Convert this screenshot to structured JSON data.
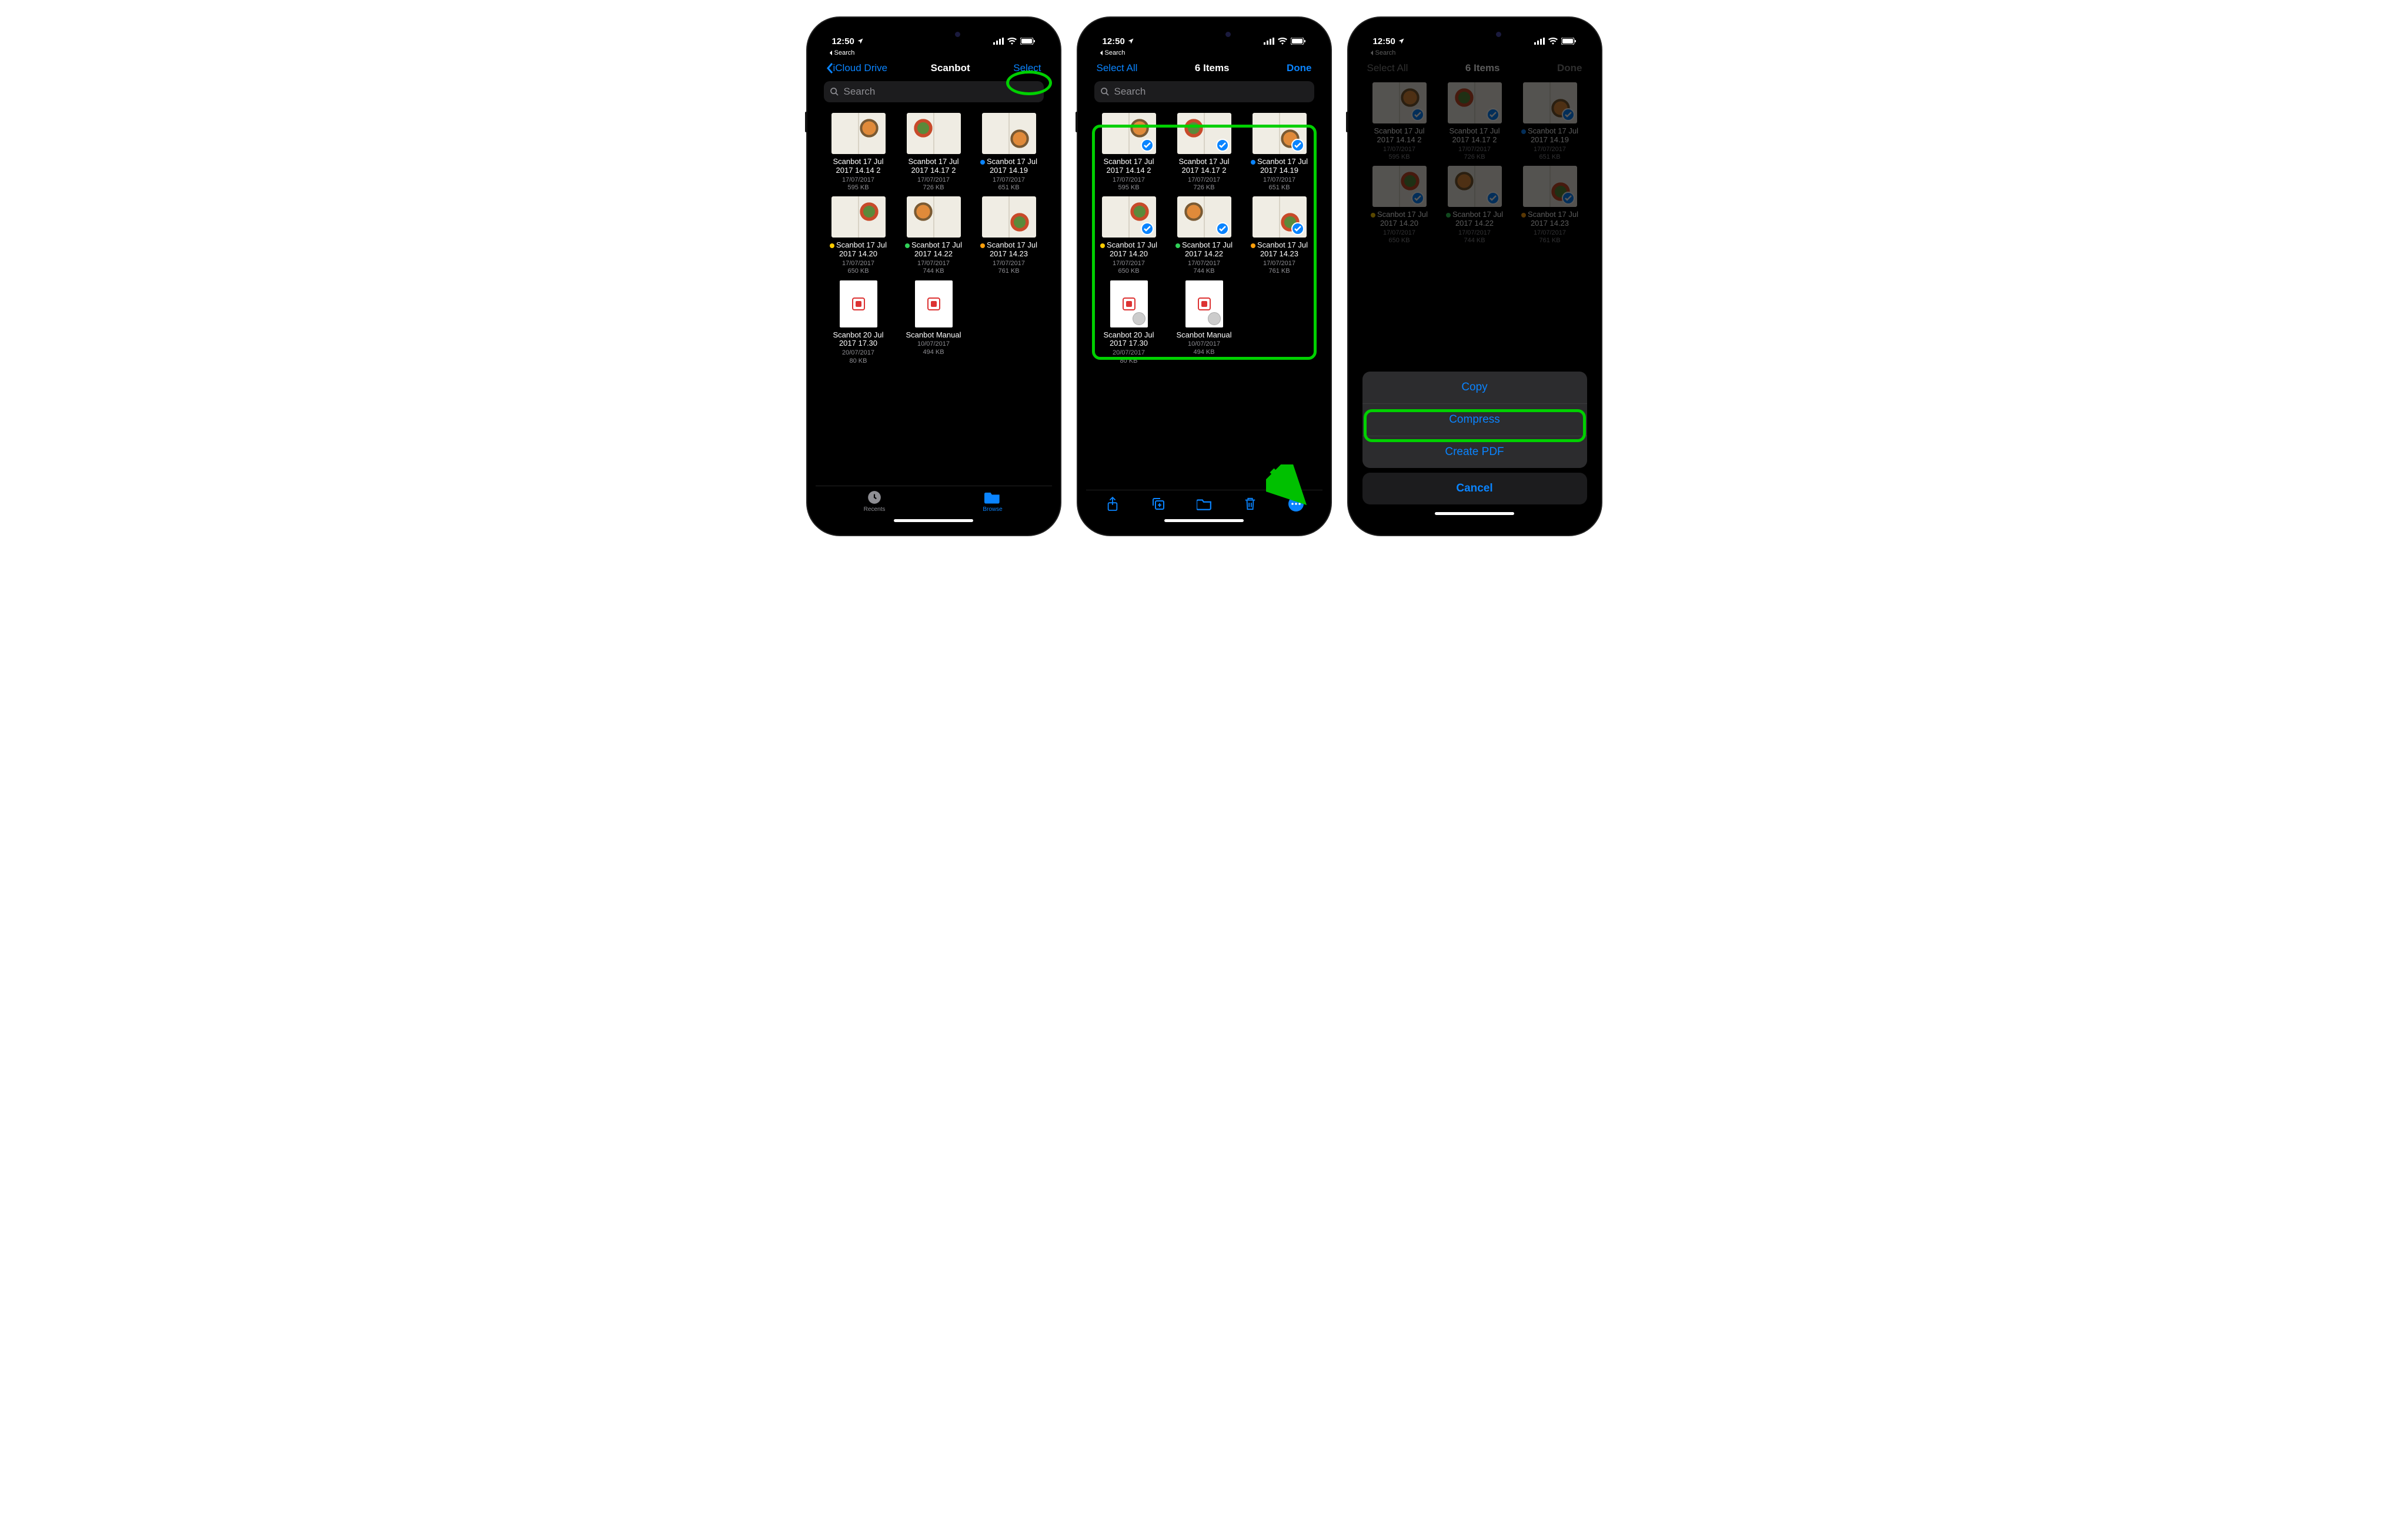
{
  "status": {
    "time": "12:50",
    "crumb": "Search"
  },
  "colors": {
    "blue": "#0a84ff",
    "yellow": "#ffcc00",
    "green": "#30d158",
    "orange": "#ff9f0a"
  },
  "p1": {
    "back": "iCloud Drive",
    "title": "Scanbot",
    "select": "Select",
    "search_ph": "Search",
    "tab_recents": "Recents",
    "tab_browse": "Browse"
  },
  "p2": {
    "selectall": "Select All",
    "title": "6 Items",
    "done": "Done",
    "search_ph": "Search"
  },
  "p3": {
    "selectall": "Select All",
    "title": "6 Items",
    "done": "Done",
    "actions": {
      "copy": "Copy",
      "compress": "Compress",
      "pdf": "Create PDF",
      "cancel": "Cancel"
    }
  },
  "files": [
    {
      "name": "Scanbot 17 Jul 2017 14.14 2",
      "date": "17/07/2017",
      "size": "595 KB",
      "tag": null,
      "kind": "page"
    },
    {
      "name": "Scanbot 17 Jul 2017 14.17 2",
      "date": "17/07/2017",
      "size": "726 KB",
      "tag": null,
      "kind": "page"
    },
    {
      "name": "Scanbot 17 Jul 2017 14.19",
      "date": "17/07/2017",
      "size": "651 KB",
      "tag": "blue",
      "kind": "page"
    },
    {
      "name": "Scanbot 17 Jul 2017 14.20",
      "date": "17/07/2017",
      "size": "650 KB",
      "tag": "yellow",
      "kind": "page"
    },
    {
      "name": "Scanbot 17 Jul 2017 14.22",
      "date": "17/07/2017",
      "size": "744 KB",
      "tag": "green",
      "kind": "page"
    },
    {
      "name": "Scanbot 17 Jul 2017 14.23",
      "date": "17/07/2017",
      "size": "761 KB",
      "tag": "orange",
      "kind": "page"
    },
    {
      "name": "Scanbot 20 Jul 2017 17.30",
      "date": "20/07/2017",
      "size": "80 KB",
      "tag": null,
      "kind": "doc"
    },
    {
      "name": "Scanbot Manual",
      "date": "10/07/2017",
      "size": "494 KB",
      "tag": null,
      "kind": "doc"
    }
  ]
}
